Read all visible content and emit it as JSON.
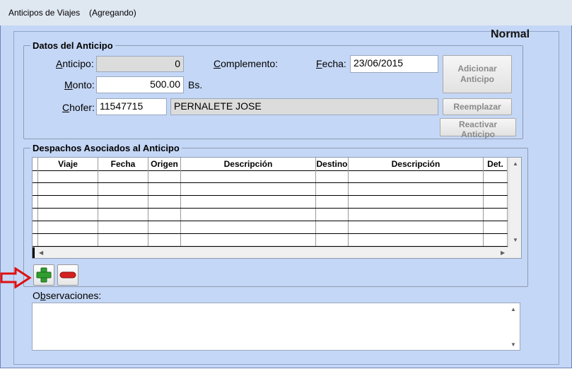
{
  "window": {
    "title": "Anticipos de Viajes",
    "mode": "(Agregando)"
  },
  "status_label": "Normal",
  "datos": {
    "legend": "Datos del Anticipo",
    "anticipo_label": "Anticipo:",
    "anticipo_value": "0",
    "complemento_label": "Complemento:",
    "fecha_label": "Fecha:",
    "fecha_value": "23/06/2015",
    "monto_label": "Monto:",
    "monto_value": "500.00",
    "currency": "Bs.",
    "chofer_label": "Chofer:",
    "chofer_id": "11547715",
    "chofer_name": "PERNALETE JOSE",
    "adicionar_line1": "Adicionar",
    "adicionar_line2": "Anticipo",
    "reemplazar": "Reemplazar",
    "reactivar": "Reactivar Anticipo"
  },
  "despachos": {
    "legend": "Despachos Asociados al Anticipo",
    "columns": [
      "Viaje",
      "Fecha",
      "Origen",
      "Descripción",
      "Destino",
      "Descripción",
      "Det."
    ],
    "rows": [
      [
        "",
        "",
        "",
        "",
        "",
        "",
        ""
      ],
      [
        "",
        "",
        "",
        "",
        "",
        "",
        ""
      ],
      [
        "",
        "",
        "",
        "",
        "",
        "",
        ""
      ],
      [
        "",
        "",
        "",
        "",
        "",
        "",
        ""
      ],
      [
        "",
        "",
        "",
        "",
        "",
        "",
        ""
      ],
      [
        "",
        "",
        "",
        "",
        "",
        "",
        ""
      ]
    ]
  },
  "observaciones": {
    "label": "Observaciones:",
    "value": ""
  },
  "colors": {
    "client_bg": "#c5d7f6",
    "add_green": "#2f9e2f",
    "remove_red": "#d42020",
    "arrow_red": "#e01010"
  },
  "icons": {
    "add": "plus-icon",
    "remove": "minus-icon",
    "pointer": "arrow-right-icon"
  }
}
